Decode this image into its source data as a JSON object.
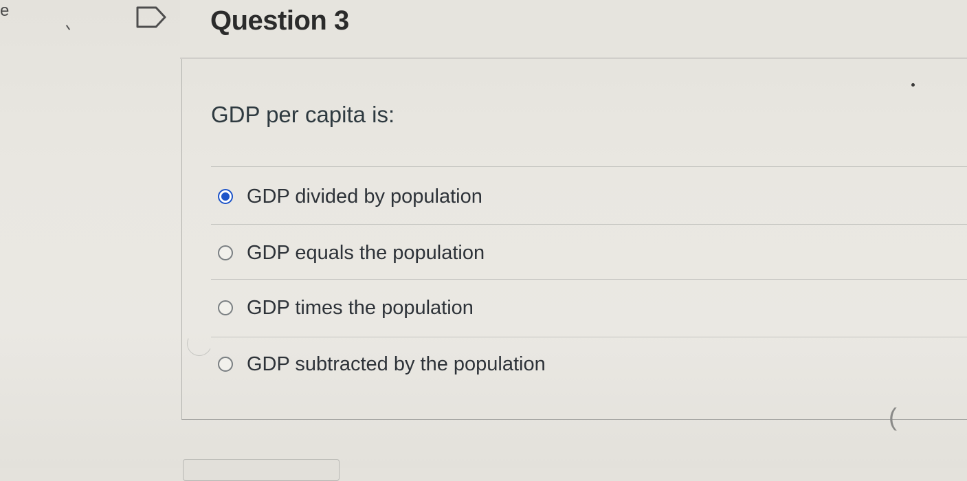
{
  "edge_text": "e",
  "question": {
    "title": "Question 3",
    "text": "GDP per capita is:",
    "flag_icon": "flag-outline-icon"
  },
  "answers": [
    {
      "label": "GDP divided by population",
      "selected": true
    },
    {
      "label": "GDP equals the population",
      "selected": false
    },
    {
      "label": "GDP times the population",
      "selected": false
    },
    {
      "label": "GDP subtracted by the population",
      "selected": false
    }
  ],
  "colors": {
    "selected_radio": "#1d54c9",
    "text": "#2d3238",
    "background": "#e9e7e1"
  }
}
